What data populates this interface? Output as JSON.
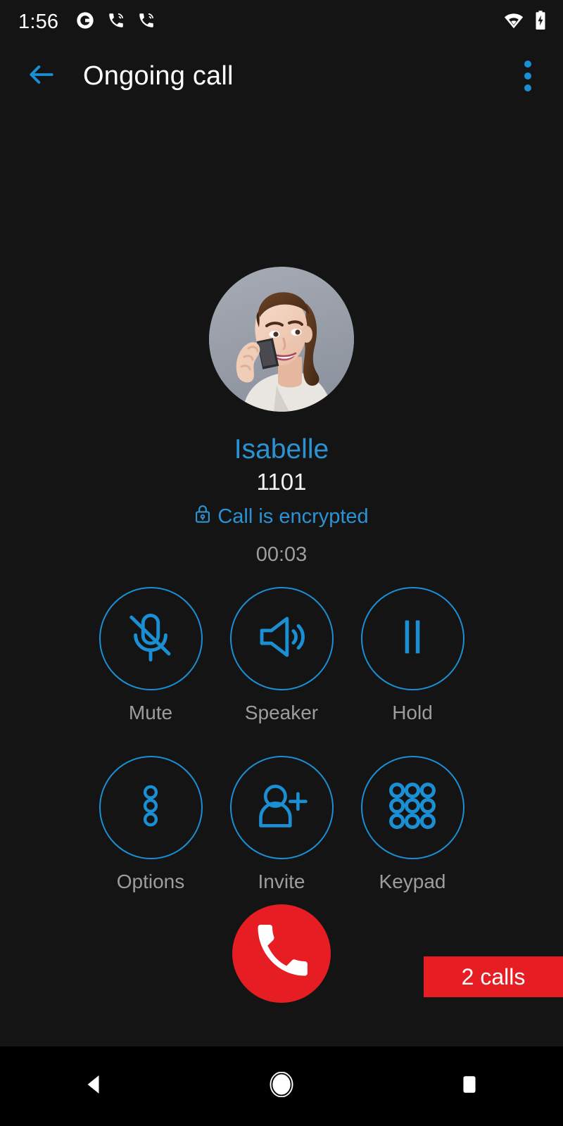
{
  "statusbar": {
    "clock": "1:56",
    "icons_left": [
      "data-saver-icon",
      "active-call-icon",
      "active-call-icon"
    ],
    "icons_right": [
      "wifi-icon",
      "battery-charging-icon"
    ]
  },
  "appbar": {
    "title": "Ongoing call",
    "back_icon": "back-arrow-icon",
    "overflow_icon": "overflow-menu-icon"
  },
  "call": {
    "avatar_alt": "contact-photo",
    "name": "Isabelle",
    "number": "1101",
    "encryption_label": "Call is encrypted",
    "encryption_icon": "lock-icon",
    "duration": "00:03"
  },
  "actions": [
    [
      {
        "label": "Mute",
        "icon": "mic-off-icon"
      },
      {
        "label": "Speaker",
        "icon": "speaker-icon"
      },
      {
        "label": "Hold",
        "icon": "pause-icon"
      }
    ],
    [
      {
        "label": "Options",
        "icon": "more-vertical-icon"
      },
      {
        "label": "Invite",
        "icon": "person-add-icon"
      },
      {
        "label": "Keypad",
        "icon": "dialpad-icon"
      }
    ]
  ],
  "hangup": {
    "icon": "hangup-phone-icon",
    "label": "End call"
  },
  "banner": {
    "text": "2 calls"
  },
  "navbar": {
    "back": "nav-back-icon",
    "home": "nav-home-icon",
    "recents": "nav-recents-icon"
  },
  "colors": {
    "accent": "#1b8fd4",
    "name_blue": "#2b93d4",
    "danger": "#e71d24",
    "background": "#141414",
    "navbar": "#000000",
    "label_gray": "#9d9d9d",
    "white": "#ffffff"
  }
}
